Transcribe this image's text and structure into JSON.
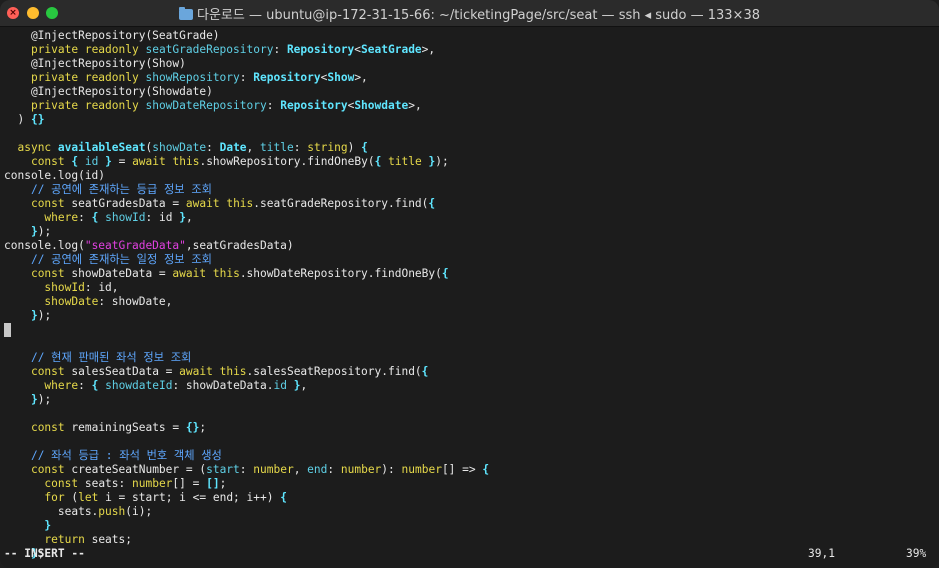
{
  "window": {
    "title": "다운로드 — ubuntu@ip-172-31-15-66: ~/ticketingPage/src/seat — ssh ◂ sudo — 133×38",
    "folder_icon": "folder-icon"
  },
  "code_lines": [
    [
      [
        "    @InjectRepository(SeatGrade)",
        ""
      ]
    ],
    [
      [
        "    ",
        ""
      ],
      [
        "private readonly ",
        "kw"
      ],
      [
        "seatGradeRepository",
        "var"
      ],
      [
        ": ",
        ""
      ],
      [
        "Repository",
        "typ"
      ],
      [
        "<",
        ""
      ],
      [
        "SeatGrade",
        "typ"
      ],
      [
        ">,",
        ""
      ]
    ],
    [
      [
        "    @InjectRepository(Show)",
        ""
      ]
    ],
    [
      [
        "    ",
        ""
      ],
      [
        "private readonly ",
        "kw"
      ],
      [
        "showRepository",
        "var"
      ],
      [
        ": ",
        ""
      ],
      [
        "Repository",
        "typ"
      ],
      [
        "<",
        ""
      ],
      [
        "Show",
        "typ"
      ],
      [
        ">,",
        ""
      ]
    ],
    [
      [
        "    @InjectRepository(Showdate)",
        ""
      ]
    ],
    [
      [
        "    ",
        ""
      ],
      [
        "private readonly ",
        "kw"
      ],
      [
        "showDateRepository",
        "var"
      ],
      [
        ": ",
        ""
      ],
      [
        "Repository",
        "typ"
      ],
      [
        "<",
        ""
      ],
      [
        "Showdate",
        "typ"
      ],
      [
        ">,",
        ""
      ]
    ],
    [
      [
        "  ) ",
        ""
      ],
      [
        "{}",
        "br"
      ]
    ],
    [
      [
        "",
        ""
      ]
    ],
    [
      [
        "  ",
        ""
      ],
      [
        "async ",
        "kw"
      ],
      [
        "availableSeat",
        "fn"
      ],
      [
        "(",
        ""
      ],
      [
        "showDate",
        "var"
      ],
      [
        ": ",
        ""
      ],
      [
        "Date",
        "typ"
      ],
      [
        ", ",
        ""
      ],
      [
        "title",
        "var"
      ],
      [
        ": ",
        ""
      ],
      [
        "string",
        "kw"
      ],
      [
        ") ",
        ""
      ],
      [
        "{",
        "br"
      ]
    ],
    [
      [
        "    ",
        ""
      ],
      [
        "const",
        "kw"
      ],
      [
        " ",
        ""
      ],
      [
        "{",
        "br"
      ],
      [
        " id ",
        "var"
      ],
      [
        "}",
        "br"
      ],
      [
        " = ",
        ""
      ],
      [
        "await",
        "kw"
      ],
      [
        " ",
        ""
      ],
      [
        "this",
        "kw"
      ],
      [
        ".showRepository.findOneBy(",
        ""
      ],
      [
        "{",
        "br"
      ],
      [
        " ",
        ""
      ],
      [
        "title",
        "kw"
      ],
      [
        " ",
        ""
      ],
      [
        "}",
        "br"
      ],
      [
        ");",
        ""
      ]
    ],
    [
      [
        "console.log(id)",
        ""
      ]
    ],
    [
      [
        "    ",
        ""
      ],
      [
        "// 공연에 존재하는 등급 정보 조회",
        "cm"
      ]
    ],
    [
      [
        "    ",
        ""
      ],
      [
        "const",
        "kw"
      ],
      [
        " seatGradesData = ",
        ""
      ],
      [
        "await",
        "kw"
      ],
      [
        " ",
        ""
      ],
      [
        "this",
        "kw"
      ],
      [
        ".seatGradeRepository.find(",
        ""
      ],
      [
        "{",
        "br"
      ]
    ],
    [
      [
        "      ",
        ""
      ],
      [
        "where",
        "kw"
      ],
      [
        ": ",
        ""
      ],
      [
        "{",
        "br"
      ],
      [
        " ",
        ""
      ],
      [
        "showId",
        "var"
      ],
      [
        ": id ",
        ""
      ],
      [
        "}",
        "br"
      ],
      [
        ",",
        ""
      ]
    ],
    [
      [
        "    ",
        ""
      ],
      [
        "}",
        "br"
      ],
      [
        ");",
        ""
      ]
    ],
    [
      [
        "console.log(",
        ""
      ],
      [
        "\"seatGradeData\"",
        "str"
      ],
      [
        ",seatGradesData)",
        ""
      ]
    ],
    [
      [
        "    ",
        ""
      ],
      [
        "// 공연에 존재하는 일정 정보 조회",
        "cm"
      ]
    ],
    [
      [
        "    ",
        ""
      ],
      [
        "const",
        "kw"
      ],
      [
        " showDateData = ",
        ""
      ],
      [
        "await",
        "kw"
      ],
      [
        " ",
        ""
      ],
      [
        "this",
        "kw"
      ],
      [
        ".showDateRepository.findOneBy(",
        ""
      ],
      [
        "{",
        "br"
      ]
    ],
    [
      [
        "      ",
        ""
      ],
      [
        "showId",
        "kw"
      ],
      [
        ": id,",
        ""
      ]
    ],
    [
      [
        "      ",
        ""
      ],
      [
        "showDate",
        "kw"
      ],
      [
        ": showDate,",
        ""
      ]
    ],
    [
      [
        "    ",
        ""
      ],
      [
        "}",
        "br"
      ],
      [
        ");",
        ""
      ]
    ],
    [
      [
        "",
        ""
      ]
    ],
    [
      [
        "",
        ""
      ]
    ],
    [
      [
        "    ",
        ""
      ],
      [
        "// 현재 판매된 좌석 정보 조회",
        "cm"
      ]
    ],
    [
      [
        "    ",
        ""
      ],
      [
        "const",
        "kw"
      ],
      [
        " salesSeatData = ",
        ""
      ],
      [
        "await",
        "kw"
      ],
      [
        " ",
        ""
      ],
      [
        "this",
        "kw"
      ],
      [
        ".salesSeatRepository.find(",
        ""
      ],
      [
        "{",
        "br"
      ]
    ],
    [
      [
        "      ",
        ""
      ],
      [
        "where",
        "kw"
      ],
      [
        ": ",
        ""
      ],
      [
        "{",
        "br"
      ],
      [
        " ",
        ""
      ],
      [
        "showdateId",
        "var"
      ],
      [
        ": showDateData.",
        ""
      ],
      [
        "id",
        "var"
      ],
      [
        " ",
        ""
      ],
      [
        "}",
        "br"
      ],
      [
        ",",
        ""
      ]
    ],
    [
      [
        "    ",
        ""
      ],
      [
        "}",
        "br"
      ],
      [
        ");",
        ""
      ]
    ],
    [
      [
        "",
        ""
      ]
    ],
    [
      [
        "    ",
        ""
      ],
      [
        "const",
        "kw"
      ],
      [
        " remainingSeats = ",
        ""
      ],
      [
        "{}",
        "br"
      ],
      [
        ";",
        ""
      ]
    ],
    [
      [
        "",
        ""
      ]
    ],
    [
      [
        "    ",
        ""
      ],
      [
        "// 좌석 등급 : 좌석 번호 객체 생성",
        "cm"
      ]
    ],
    [
      [
        "    ",
        ""
      ],
      [
        "const",
        "kw"
      ],
      [
        " createSeatNumber = (",
        ""
      ],
      [
        "start",
        "var"
      ],
      [
        ": ",
        ""
      ],
      [
        "number",
        "kw"
      ],
      [
        ", ",
        ""
      ],
      [
        "end",
        "var"
      ],
      [
        ": ",
        ""
      ],
      [
        "number",
        "kw"
      ],
      [
        "): ",
        ""
      ],
      [
        "number",
        "kw"
      ],
      [
        "[] => ",
        ""
      ],
      [
        "{",
        "br"
      ]
    ],
    [
      [
        "      ",
        ""
      ],
      [
        "const",
        "kw"
      ],
      [
        " seats: ",
        ""
      ],
      [
        "number",
        "kw"
      ],
      [
        "[] = ",
        ""
      ],
      [
        "[]",
        "br"
      ],
      [
        ";",
        ""
      ]
    ],
    [
      [
        "      ",
        ""
      ],
      [
        "for",
        "kw"
      ],
      [
        " (",
        ""
      ],
      [
        "let",
        "kw"
      ],
      [
        " i = start; i <= end; i++) ",
        ""
      ],
      [
        "{",
        "br"
      ]
    ],
    [
      [
        "        seats.",
        ""
      ],
      [
        "push",
        "kw"
      ],
      [
        "(i);",
        ""
      ]
    ],
    [
      [
        "      ",
        ""
      ],
      [
        "}",
        "br"
      ]
    ],
    [
      [
        "      ",
        ""
      ],
      [
        "return",
        "kw"
      ],
      [
        " seats;",
        ""
      ]
    ],
    [
      [
        "    ",
        ""
      ],
      [
        "}",
        "br"
      ],
      [
        ";",
        ""
      ]
    ]
  ],
  "status": {
    "mode": "-- INSERT --",
    "position": "39,1",
    "percent": "39%"
  }
}
